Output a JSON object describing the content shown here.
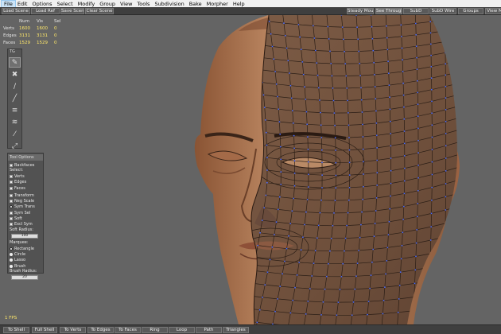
{
  "menu": [
    "File",
    "Edit",
    "Options",
    "Select",
    "Modify",
    "Group",
    "View",
    "Tools",
    "Subdivision",
    "Bake",
    "Morpher",
    "Help"
  ],
  "toolbar_left": [
    "Load Scene",
    "Load Ref",
    "Save Scene",
    "Clear Scene"
  ],
  "toolbar_right": [
    "Steady Mouse",
    "See Through",
    "SubD",
    "SubD Wire",
    "Groups",
    "View M"
  ],
  "stats": {
    "headers": [
      "",
      "Num",
      "Vis",
      "Sel"
    ],
    "rows": [
      [
        "Verts",
        "1600",
        "1600",
        "0"
      ],
      [
        "Edges",
        "3131",
        "3131",
        "0"
      ],
      [
        "Faces",
        "1529",
        "1529",
        "0"
      ]
    ]
  },
  "toolstrip": {
    "label": "TG",
    "tools": [
      "brush-select-icon",
      "cross-move-icon",
      "pen-icon",
      "knife-icon",
      "weld-icon",
      "smooth-icon",
      "eyedropper-icon",
      "scale-icon"
    ]
  },
  "tool_options": {
    "title": "Tool Options",
    "backfaces": "Backfaces",
    "select_label": "Select:",
    "select_items": [
      "Verts",
      "Edges",
      "Faces"
    ],
    "toggles": [
      "Transform",
      "Neg Scale",
      "Sym Trans",
      "Sym Sel",
      "Soft",
      "Excl Sym"
    ],
    "soft_radius_label": "Soft Radius:",
    "soft_radius_value": "100",
    "marquee_label": "Marquee:",
    "marquee_items": [
      "Rectangle",
      "Circle",
      "Lasso",
      "Brush"
    ],
    "brush_radius_label": "Brush Radius:",
    "brush_radius_value": "20"
  },
  "fps": "1 FPS",
  "bottom_buttons": [
    "To Shell",
    "Full Shell",
    "To Verts",
    "To Edges",
    "To Faces",
    "Ring",
    "Loop",
    "Path",
    "Triangles"
  ],
  "colors": {
    "viewport_bg": "#646464",
    "skin": "#b07a55",
    "mesh_skin": "#7a5a44",
    "wire": "#2b1e16",
    "vertex": "#4a6cff",
    "stat_yellow": "#ffe86a"
  }
}
